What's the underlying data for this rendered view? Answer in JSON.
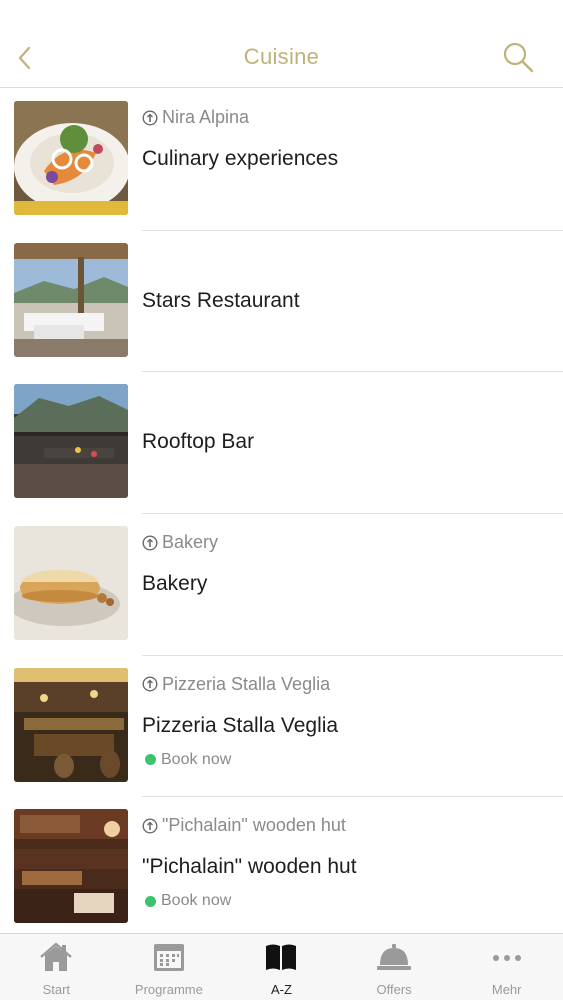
{
  "header": {
    "title": "Cuisine",
    "accent_color": "#bfb27a"
  },
  "list": {
    "items": [
      {
        "subtitle": "Nira Alpina",
        "name": "Culinary experiences",
        "book": ""
      },
      {
        "subtitle": "",
        "name": "Stars Restaurant",
        "book": ""
      },
      {
        "subtitle": "",
        "name": "Rooftop Bar",
        "book": ""
      },
      {
        "subtitle": "Bakery",
        "name": "Bakery",
        "book": ""
      },
      {
        "subtitle": "Pizzeria Stalla Veglia",
        "name": "Pizzeria Stalla Veglia",
        "book": "Book now"
      },
      {
        "subtitle": "\"Pichalain\" wooden hut",
        "name": "\"Pichalain\" wooden hut",
        "book": "Book now"
      }
    ],
    "book_status_color": "#3cc36b"
  },
  "tabbar": {
    "tabs": [
      {
        "label": "Start",
        "icon": "home-icon"
      },
      {
        "label": "Programme",
        "icon": "calendar-icon"
      },
      {
        "label": "A-Z",
        "icon": "book-icon",
        "active": true
      },
      {
        "label": "Offers",
        "icon": "service-bell-icon"
      },
      {
        "label": "Mehr",
        "icon": "more-icon"
      }
    ]
  }
}
